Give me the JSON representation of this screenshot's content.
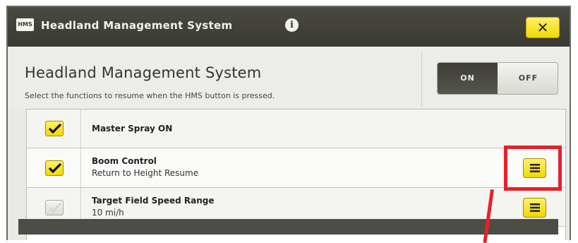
{
  "window": {
    "logo_text": "HMS",
    "title": "Headland Management System",
    "info_icon": "info-icon",
    "close_label": "✕"
  },
  "header": {
    "heading": "Headland Management System",
    "subtitle": "Select the functions to resume when the HMS button is pressed.",
    "toggle": {
      "on_label": "ON",
      "off_label": "OFF",
      "selected": "ON"
    }
  },
  "functions": [
    {
      "title": "Master Spray ON",
      "subtitle": "",
      "checked": true,
      "has_options": false
    },
    {
      "title": "Boom Control",
      "subtitle": "Return to Height Resume",
      "checked": true,
      "has_options": true
    },
    {
      "title": "Target Field Speed Range",
      "subtitle": "10 mi/h",
      "checked": false,
      "has_options": true
    }
  ],
  "annotation": {
    "color": "#e8202a"
  },
  "colors": {
    "accent_yellow": "#f1d800",
    "titlebar": "#3a3a33"
  }
}
